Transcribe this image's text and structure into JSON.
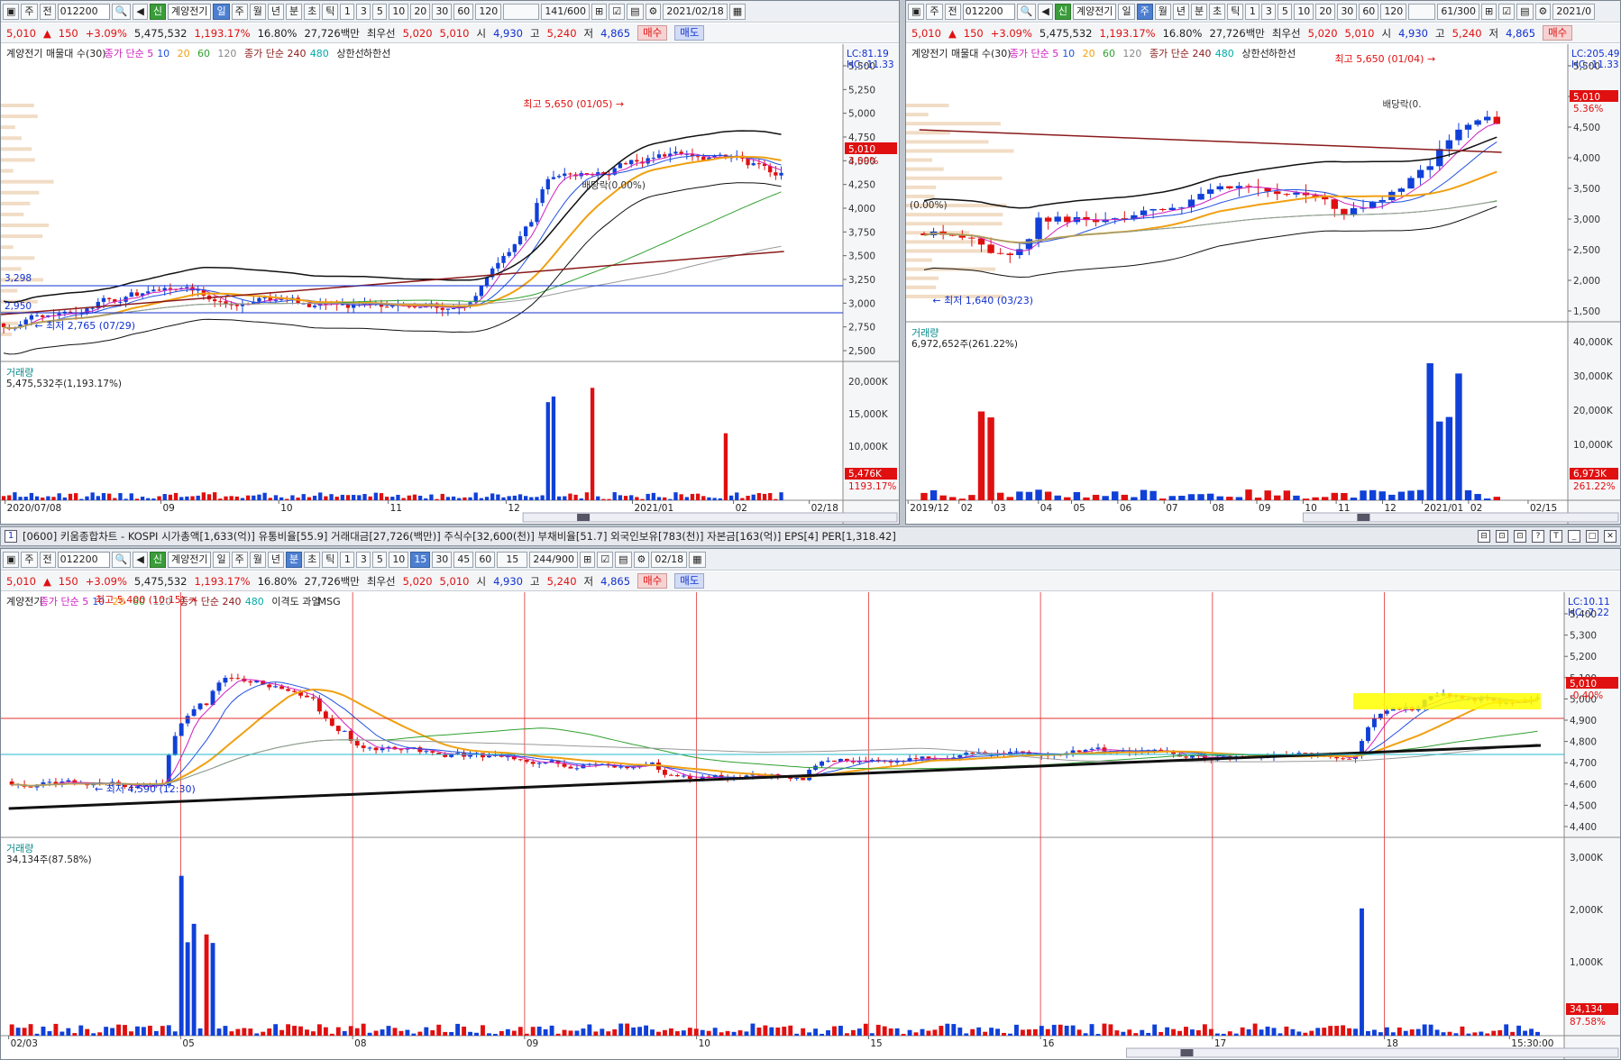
{
  "common": {
    "code": "012200",
    "name": "계양전기",
    "price": "5,010",
    "arrow": "▲",
    "change": "150",
    "pct": "+3.09%",
    "volume": "5,475,532",
    "vol_pct": "1,193.17%",
    "turnover": "16.80%",
    "amount": "27,726백만",
    "pref_label": "최우선",
    "ask": "5,020",
    "bid": "5,010",
    "open_label": "시",
    "open": "4,930",
    "high_label": "고",
    "high": "5,240",
    "low_label": "저",
    "low": "4,865",
    "buy": "매수",
    "sell": "매도",
    "new_badge": "신",
    "type_label": "주",
    "ref_label": "전"
  },
  "toolbar": {
    "periods": [
      "일",
      "주",
      "월",
      "년",
      "분",
      "초",
      "틱"
    ],
    "nums": [
      "1",
      "3",
      "5",
      "10",
      "20",
      "30",
      "60",
      "120"
    ],
    "nums_bottom": [
      "1",
      "3",
      "5",
      "10",
      "15",
      "30",
      "45",
      "60"
    ]
  },
  "tl": {
    "count": "141",
    "max": "/600",
    "date": "2021/02/18",
    "legend": [
      "계양전기 매물대 수(30)",
      "종가 단순 5",
      "10",
      "20",
      "60",
      "120",
      "종가 단순 240",
      "480",
      "상한선",
      "하한선"
    ],
    "lc": "LC:81.19",
    "hc": "HC:-11.33",
    "y": [
      "5,500",
      "5,250",
      "5,000",
      "4,750",
      "4,500",
      "4,250",
      "4,000",
      "3,750",
      "3,500",
      "3,250",
      "3,000",
      "2,750",
      "2,500"
    ],
    "price_tag": "5,010",
    "pct_tag": "3.09%",
    "high_note": "최고 5,650 (01/05)",
    "low_note": "최저 2,765 (07/29)",
    "div_note": "배당락(0.00%)",
    "lvl1": "3,298",
    "lvl2": "2,950",
    "vol_title": "거래량",
    "vol_val": "5,475,532주(1,193.17%)",
    "vy": [
      "20,000K",
      "15,000K",
      "10,000K"
    ],
    "vtag": "5,476K",
    "vtag2": "1193.17%",
    "x": [
      "2020/07/08",
      "09",
      "10",
      "11",
      "12",
      "2021/01",
      "02",
      "02/18"
    ]
  },
  "tr": {
    "count": "61",
    "max": "/300",
    "date": "2021/0",
    "legend": [
      "계양전기 매물대 수(30)",
      "종가 단순 5",
      "10",
      "20",
      "60",
      "120",
      "종가 단순 240",
      "480",
      "상한선",
      "하한선"
    ],
    "lc": "LC:205.49",
    "hc": "HC:-11.33",
    "y": [
      "5,500",
      "5,000",
      "4,500",
      "4,000",
      "3,500",
      "3,000",
      "2,500",
      "2,000",
      "1,500"
    ],
    "price_tag": "5,010",
    "pct_tag": "5.36%",
    "high_note": "최고 5,650 (01/04)",
    "low_note": "최저 1,640 (03/23)",
    "div_note": "배당락(0.",
    "zero_note": "(0.00%)",
    "vol_title": "거래량",
    "vol_val": "6,972,652주(261.22%)",
    "vy": [
      "40,000K",
      "30,000K",
      "20,000K",
      "10,000K"
    ],
    "vtag": "6,973K",
    "vtag2": "261.22%",
    "x": [
      "2019/12",
      "02",
      "03",
      "04",
      "05",
      "06",
      "07",
      "08",
      "09",
      "10",
      "11",
      "12",
      "2021/01",
      "02",
      "02/15"
    ]
  },
  "mid": {
    "num": "1",
    "text": "[0600] 키움종합차트 - KOSPI 시가총액[1,633(억)] 유통비율[55.9] 거래대금[27,726(백만)] 주식수[32,600(천)] 부채비율[51.7] 외국인보유[783(천)] 자본금[163(억)] EPS[4] PER[1,318.42]"
  },
  "bt": {
    "interval": "15",
    "count": "244",
    "max": "/900",
    "date": "02/18",
    "legend": [
      "계양전기",
      "종가 단순 5",
      "10",
      "20",
      "60",
      "120",
      "종가 단순 240",
      "480",
      "이격도 과열",
      "MSG"
    ],
    "lc": "LC:10.11",
    "hc": "HC:-7.22",
    "y": [
      "5,400",
      "5,300",
      "5,200",
      "5,100",
      "5,000",
      "4,900",
      "4,800",
      "4,700",
      "4,600",
      "4,500",
      "4,400"
    ],
    "price_tag": "5,010",
    "pct_tag": "-0.40%",
    "high_note": "최고 5,400 (10:15)",
    "low_note": "최저 4,590 (12:30)",
    "vol_title": "거래량",
    "vol_val": "34,134주(87.58%)",
    "vy": [
      "3,000K",
      "2,000K",
      "1,000K"
    ],
    "vtag": "34,134",
    "vtag2": "87.58%",
    "x": [
      "02/03",
      "05",
      "08",
      "09",
      "10",
      "15",
      "16",
      "17",
      "18",
      "15:30:00"
    ]
  },
  "colors": {
    "up": "#e01010",
    "down": "#1040d8",
    "ma5": "#d020c0",
    "ma10": "#2050e0",
    "ma20": "#f0a010",
    "ma60": "#30a030",
    "ma120": "#9a9a9a",
    "ma240": "#8b1a1a",
    "band": "#111111",
    "highlight": "#ffff00"
  }
}
